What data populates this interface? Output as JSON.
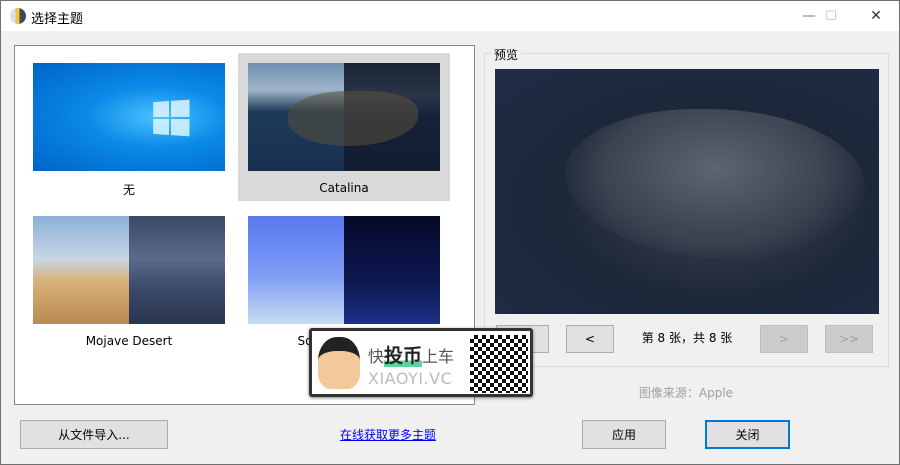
{
  "window": {
    "title": "选择主题",
    "minimize": "—",
    "maximize": "☐",
    "close": "✕"
  },
  "themes": [
    {
      "label": "无",
      "selected": false
    },
    {
      "label": "Catalina",
      "selected": true
    },
    {
      "label": "Mojave Desert",
      "selected": false
    },
    {
      "label": "Solar Gradients",
      "selected": false
    }
  ],
  "preview": {
    "group_label": "预览",
    "first": "<<",
    "prev": "<",
    "counter": "第 8 张，共 8 张",
    "next": ">",
    "last": ">>",
    "source": "图像来源：Apple"
  },
  "footer": {
    "import": "从文件导入...",
    "more_link": "在线获取更多主题",
    "apply": "应用",
    "close": "关闭"
  },
  "watermark": {
    "text1": "快",
    "text2": "投币",
    "text3": "上车",
    "domain": "XIAOYI.VC"
  }
}
